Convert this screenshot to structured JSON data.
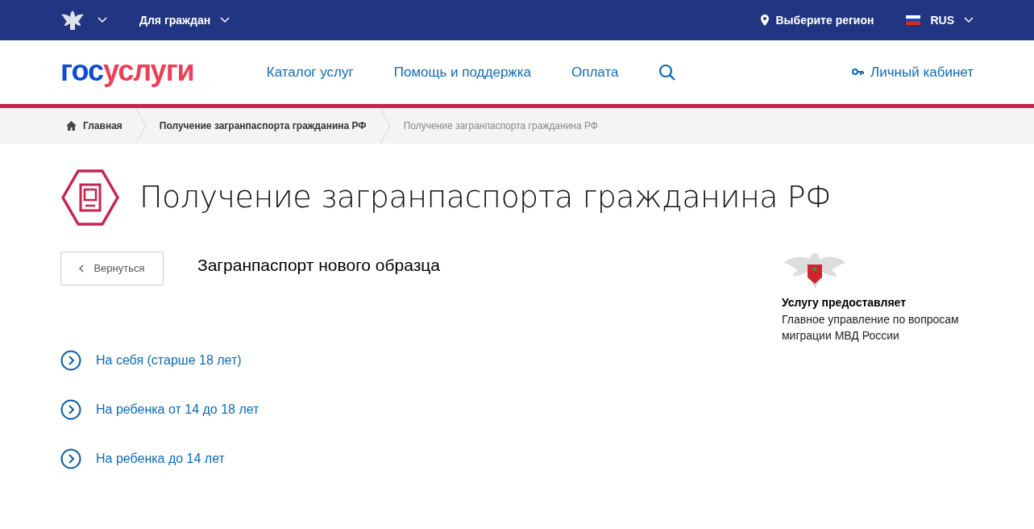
{
  "top_bar": {
    "section": "Для граждан",
    "region": "Выберите регион",
    "language": "RUS"
  },
  "header": {
    "logo": {
      "first": "гос",
      "second": "услуги"
    },
    "nav": [
      "Каталог услуг",
      "Помощь и поддержка",
      "Оплата"
    ],
    "account": "Личный кабинет"
  },
  "breadcrumbs": [
    {
      "label": "Главная",
      "current": false
    },
    {
      "label": "Получение загранпаспорта гражданина РФ",
      "current": false
    },
    {
      "label": "Получение загранпаспорта гражданина РФ",
      "current": true
    }
  ],
  "page_title": "Получение загранпаспорта гражданина РФ",
  "back_button": "Вернуться",
  "subtitle": "Загранпаспорт нового образца",
  "options": [
    "На себя (старше 18 лет)",
    "На ребенка от 14 до 18 лет",
    "На ребенка до 14 лет"
  ],
  "provider": {
    "heading": "Услугу предоставляет",
    "name": "Главное управление по вопросам миграции МВД России"
  }
}
